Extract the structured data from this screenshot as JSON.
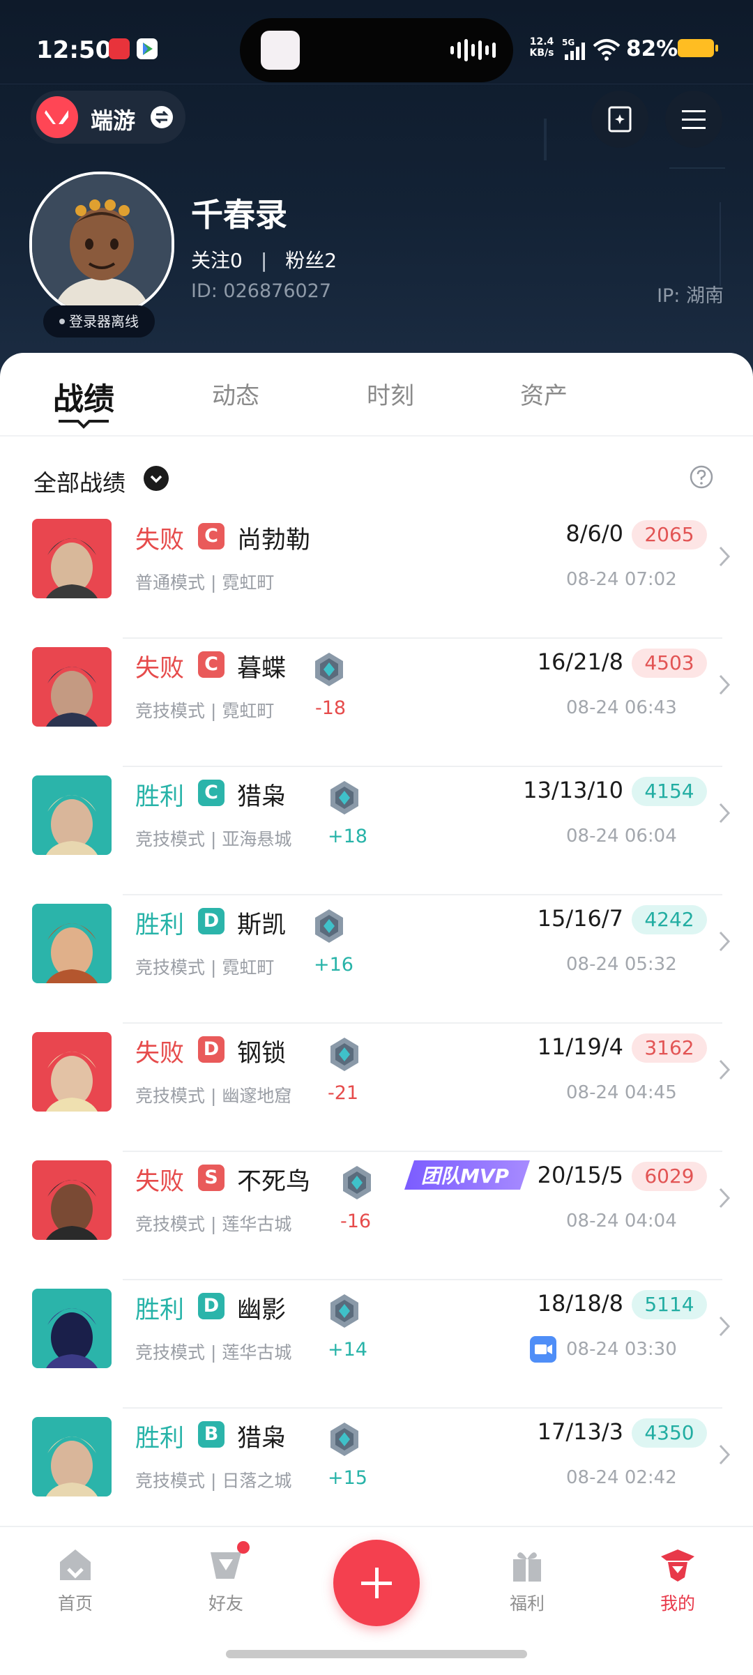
{
  "status_bar": {
    "time": "12:50",
    "net_speed_value": "12.4",
    "net_speed_unit": "KB/s",
    "network": "5G",
    "battery": "82%"
  },
  "top_bar": {
    "game_label": "端游"
  },
  "profile": {
    "name": "千春录",
    "following_label": "关注0",
    "fans_label": "粉丝2",
    "separator": "|",
    "user_id": "ID:  026876027",
    "ip": "IP:  湖南",
    "login_status": "登录器离线"
  },
  "tabs": [
    {
      "label": "战绩",
      "active": true
    },
    {
      "label": "动态",
      "active": false
    },
    {
      "label": "时刻",
      "active": false
    },
    {
      "label": "资产",
      "active": false
    }
  ],
  "filter": {
    "label": "全部战绩"
  },
  "matches": [
    {
      "result": "失败",
      "rank_letter": "C",
      "agent": "尚勃勒",
      "mode": "普通模式 | 霓虹町",
      "rank_delta": "",
      "kda": "8/6/0",
      "score": "2065",
      "time": "08-24 07:02",
      "mvp": "",
      "has_video": false,
      "colors": [
        "#e9464f",
        "#3a3a3a",
        "#d8b89a"
      ]
    },
    {
      "result": "失败",
      "rank_letter": "C",
      "agent": "暮蝶",
      "mode": "竞技模式 | 霓虹町",
      "rank_delta": "-18",
      "kda": "16/21/8",
      "score": "4503",
      "time": "08-24 06:43",
      "mvp": "",
      "has_video": false,
      "colors": [
        "#e9464f",
        "#2c3450",
        "#c49a82"
      ]
    },
    {
      "result": "胜利",
      "rank_letter": "C",
      "agent": "猎枭",
      "mode": "竞技模式 | 亚海悬城",
      "rank_delta": "+18",
      "kda": "13/13/10",
      "score": "4154",
      "time": "08-24 06:04",
      "mvp": "",
      "has_video": false,
      "colors": [
        "#2bb4aa",
        "#e8d7b0",
        "#d9b69a"
      ]
    },
    {
      "result": "胜利",
      "rank_letter": "D",
      "agent": "斯凯",
      "mode": "竞技模式 | 霓虹町",
      "rank_delta": "+16",
      "kda": "15/16/7",
      "score": "4242",
      "time": "08-24 05:32",
      "mvp": "",
      "has_video": false,
      "colors": [
        "#2bb4aa",
        "#b4562e",
        "#e0b08a"
      ]
    },
    {
      "result": "失败",
      "rank_letter": "D",
      "agent": "钢锁",
      "mode": "竞技模式 | 幽邃地窟",
      "rank_delta": "-21",
      "kda": "11/19/4",
      "score": "3162",
      "time": "08-24 04:45",
      "mvp": "",
      "has_video": false,
      "colors": [
        "#e9464f",
        "#efe0b0",
        "#e3c2a5"
      ]
    },
    {
      "result": "失败",
      "rank_letter": "S",
      "agent": "不死鸟",
      "mode": "竞技模式 | 莲华古城",
      "rank_delta": "-16",
      "kda": "20/15/5",
      "score": "6029",
      "time": "08-24 04:04",
      "mvp": "团队MVP",
      "has_video": false,
      "colors": [
        "#e9464f",
        "#2a2a2a",
        "#7a4a34"
      ]
    },
    {
      "result": "胜利",
      "rank_letter": "D",
      "agent": "幽影",
      "mode": "竞技模式 | 莲华古城",
      "rank_delta": "+14",
      "kda": "18/18/8",
      "score": "5114",
      "time": "08-24 03:30",
      "mvp": "",
      "has_video": true,
      "colors": [
        "#2bb4aa",
        "#3b3a86",
        "#1a1f4a"
      ]
    },
    {
      "result": "胜利",
      "rank_letter": "B",
      "agent": "猎枭",
      "mode": "竞技模式 | 日落之城",
      "rank_delta": "+15",
      "kda": "17/13/3",
      "score": "4350",
      "time": "08-24 02:42",
      "mvp": "",
      "has_video": false,
      "colors": [
        "#2bb4aa",
        "#e8d7b0",
        "#d9b69a"
      ]
    }
  ],
  "bottom_nav": [
    {
      "label": "首页",
      "icon": "home-icon",
      "active": false
    },
    {
      "label": "好友",
      "icon": "friends-icon",
      "active": false,
      "badge": true
    },
    {
      "label": "",
      "icon": "plus-icon",
      "active": false
    },
    {
      "label": "福利",
      "icon": "gift-icon",
      "active": false
    },
    {
      "label": "我的",
      "icon": "profile-icon",
      "active": true
    }
  ],
  "theme": {
    "lose_color": "#e64b4b",
    "win_color": "#27b3a8",
    "accent": "#f4404f",
    "header_bg": "#132235"
  }
}
